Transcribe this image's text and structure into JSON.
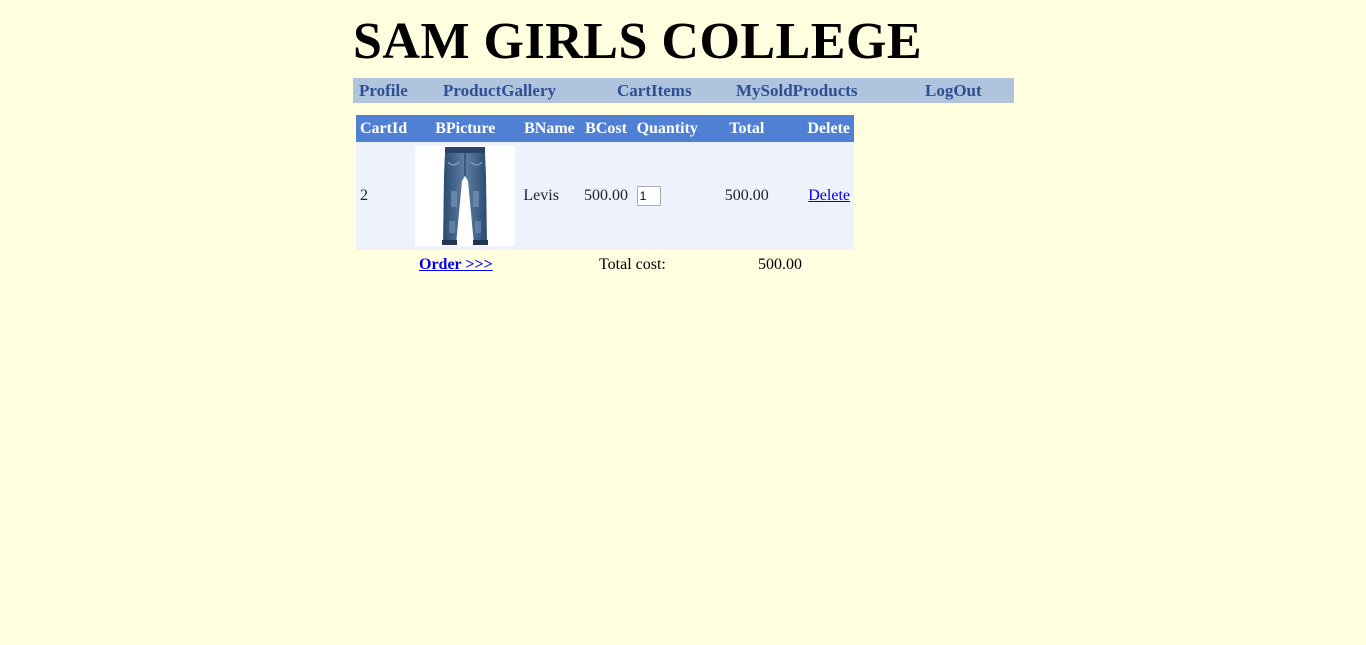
{
  "site": {
    "title": "SAM GIRLS COLLEGE"
  },
  "nav": {
    "items": [
      {
        "label": "Profile"
      },
      {
        "label": "ProductGallery"
      },
      {
        "label": "CartItems"
      },
      {
        "label": "MySoldProducts"
      },
      {
        "label": "LogOut"
      }
    ]
  },
  "cart": {
    "headers": [
      "CartId",
      "BPicture",
      "BName",
      "BCost",
      "Quantity",
      "Total",
      "Delete"
    ],
    "rows": [
      {
        "cart_id": "2",
        "picture_icon": "jeans-image",
        "name": "Levis",
        "cost": "500.00",
        "quantity": "1",
        "total": "500.00",
        "delete_label": "Delete"
      }
    ]
  },
  "footer": {
    "order_label": "Order >>>",
    "total_cost_label": "Total cost:",
    "total_cost_value": "500.00"
  },
  "colors": {
    "background": "#FFFFE0",
    "nav_background": "#B0C4DE",
    "nav_text": "#2E4F94",
    "table_header": "#5080D4",
    "table_row": "#EEF2FC",
    "link": "#0000EE"
  }
}
